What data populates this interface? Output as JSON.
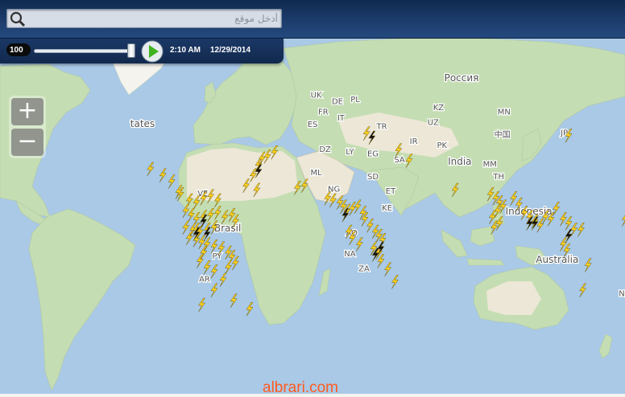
{
  "search": {
    "placeholder": "أدخل موقع"
  },
  "playback": {
    "speed": "100",
    "time": "2:10 AM",
    "date": "12/29/2014",
    "slider_position": 0.97
  },
  "zoom": {
    "in_label": "+",
    "out_label": "−"
  },
  "watermark": "albrari.com",
  "colors": {
    "ocean": "#a9c9e6",
    "land_green": "#c5ddb3",
    "land_desert": "#ece7d6",
    "land_snow": "#f4f3ee",
    "bolt": "#ffd21f"
  },
  "map_labels": [
    {
      "text": "Россия",
      "lon": 80,
      "lat": 62
    },
    {
      "text": "UK",
      "lon": -2,
      "lat": 54
    },
    {
      "text": "DE",
      "lon": 10,
      "lat": 51
    },
    {
      "text": "PL",
      "lon": 20,
      "lat": 52
    },
    {
      "text": "FR",
      "lon": 2,
      "lat": 46
    },
    {
      "text": "IT",
      "lon": 12,
      "lat": 43
    },
    {
      "text": "ES",
      "lon": -4,
      "lat": 40
    },
    {
      "text": "TR",
      "lon": 35,
      "lat": 39
    },
    {
      "text": "KZ",
      "lon": 67,
      "lat": 48
    },
    {
      "text": "UZ",
      "lon": 64,
      "lat": 41
    },
    {
      "text": "MN",
      "lon": 104,
      "lat": 46
    },
    {
      "text": "中国",
      "lon": 103,
      "lat": 35
    },
    {
      "text": "JP",
      "lon": 138,
      "lat": 36
    },
    {
      "text": "IR",
      "lon": 53,
      "lat": 32
    },
    {
      "text": "PK",
      "lon": 69,
      "lat": 30
    },
    {
      "text": "India",
      "lon": 79,
      "lat": 22
    },
    {
      "text": "MM",
      "lon": 96,
      "lat": 21
    },
    {
      "text": "TH",
      "lon": 101,
      "lat": 15
    },
    {
      "text": "DZ",
      "lon": 3,
      "lat": 28
    },
    {
      "text": "LY",
      "lon": 17,
      "lat": 27
    },
    {
      "text": "EG",
      "lon": 30,
      "lat": 26
    },
    {
      "text": "SA",
      "lon": 45,
      "lat": 23
    },
    {
      "text": "ML",
      "lon": -2,
      "lat": 17
    },
    {
      "text": "SD",
      "lon": 30,
      "lat": 15
    },
    {
      "text": "NG",
      "lon": 8,
      "lat": 9
    },
    {
      "text": "ET",
      "lon": 40,
      "lat": 8
    },
    {
      "text": "KE",
      "lon": 38,
      "lat": 0
    },
    {
      "text": "AO",
      "lon": 18,
      "lat": -12
    },
    {
      "text": "NA",
      "lon": 17,
      "lat": -22
    },
    {
      "text": "ZA",
      "lon": 25,
      "lat": -29
    },
    {
      "text": "Indonesia",
      "lon": 118,
      "lat": -2
    },
    {
      "text": "Australia",
      "lon": 134,
      "lat": -25
    },
    {
      "text": "NZ",
      "lon": 172,
      "lat": -41
    },
    {
      "text": "VE",
      "lon": -66,
      "lat": 7
    },
    {
      "text": "Brasil",
      "lon": -52,
      "lat": -10
    },
    {
      "text": "PY",
      "lon": -58,
      "lat": -23
    },
    {
      "text": "AR",
      "lon": -65,
      "lat": -34
    },
    {
      "text": "tates",
      "lon": -100,
      "lat": 40
    }
  ],
  "lightning": [
    [
      -79,
      8
    ],
    [
      -74,
      5
    ],
    [
      -70,
      4
    ],
    [
      -66,
      6
    ],
    [
      -62,
      7
    ],
    [
      -58,
      5
    ],
    [
      -76,
      0
    ],
    [
      -73,
      -2
    ],
    [
      -70,
      -4
    ],
    [
      -66,
      -3
    ],
    [
      -62,
      -2
    ],
    [
      -58,
      -1
    ],
    [
      -54,
      -3
    ],
    [
      -50,
      -2
    ],
    [
      -48,
      -5
    ],
    [
      -76,
      -8
    ],
    [
      -72,
      -9
    ],
    [
      -68,
      -10
    ],
    [
      -64,
      -9
    ],
    [
      -60,
      -8
    ],
    [
      -74,
      -13
    ],
    [
      -70,
      -14
    ],
    [
      -67,
      -15
    ],
    [
      -64,
      -16
    ],
    [
      -60,
      -17
    ],
    [
      -56,
      -18
    ],
    [
      -52,
      -20
    ],
    [
      -50,
      -22
    ],
    [
      -48,
      -25
    ],
    [
      -52,
      -27
    ],
    [
      -66,
      -20
    ],
    [
      -68,
      -24
    ],
    [
      -64,
      -27
    ],
    [
      -60,
      -29
    ],
    [
      -55,
      -33
    ],
    [
      -60,
      -38
    ],
    [
      -67,
      -45
    ],
    [
      -49,
      -43
    ],
    [
      -40,
      -47
    ],
    [
      -70,
      -9
    ],
    [
      -42,
      12
    ],
    [
      -38,
      17
    ],
    [
      -35,
      22
    ],
    [
      -33,
      25
    ],
    [
      -30,
      26
    ],
    [
      -26,
      28
    ],
    [
      -36,
      10
    ],
    [
      -13,
      11
    ],
    [
      -9,
      12
    ],
    [
      4,
      6
    ],
    [
      7,
      5
    ],
    [
      11,
      4
    ],
    [
      13,
      2
    ],
    [
      15,
      0
    ],
    [
      18,
      1
    ],
    [
      21,
      2
    ],
    [
      24,
      -1
    ],
    [
      25,
      -4
    ],
    [
      28,
      -7
    ],
    [
      31,
      -10
    ],
    [
      33,
      -12
    ],
    [
      35,
      -14
    ],
    [
      16,
      -10
    ],
    [
      18,
      -13
    ],
    [
      22,
      -16
    ],
    [
      30,
      -18
    ],
    [
      33,
      -20
    ],
    [
      34,
      -24
    ],
    [
      38,
      -28
    ],
    [
      42,
      -34
    ],
    [
      26,
      37
    ],
    [
      44,
      29
    ],
    [
      50,
      24
    ],
    [
      76,
      10
    ],
    [
      96,
      8
    ],
    [
      99,
      6
    ],
    [
      101,
      4
    ],
    [
      103,
      2
    ],
    [
      100,
      0
    ],
    [
      97,
      -3
    ],
    [
      98,
      -8
    ],
    [
      101,
      -6
    ],
    [
      109,
      6
    ],
    [
      112,
      3
    ],
    [
      115,
      -1
    ],
    [
      118,
      -3
    ],
    [
      121,
      -5
    ],
    [
      124,
      -7
    ],
    [
      127,
      -3
    ],
    [
      130,
      -4
    ],
    [
      133,
      1
    ],
    [
      137,
      -4
    ],
    [
      140,
      -6
    ],
    [
      143,
      -9
    ],
    [
      147,
      -9
    ],
    [
      137,
      -16
    ],
    [
      139,
      -19
    ],
    [
      151,
      -26
    ],
    [
      148,
      -38
    ],
    [
      140,
      36
    ],
    [
      172,
      -4
    ],
    [
      -96,
      20
    ],
    [
      -89,
      17
    ],
    [
      -84,
      14
    ],
    [
      -80,
      9
    ]
  ],
  "dark_lightning": [
    [
      -66,
      -5
    ],
    [
      -70,
      -11
    ],
    [
      -64,
      -11
    ],
    [
      14,
      -2
    ],
    [
      118,
      -6
    ],
    [
      121,
      -6
    ],
    [
      140,
      -12
    ],
    [
      34,
      -18
    ],
    [
      31,
      -21
    ],
    [
      -35,
      19
    ],
    [
      29,
      35
    ]
  ]
}
